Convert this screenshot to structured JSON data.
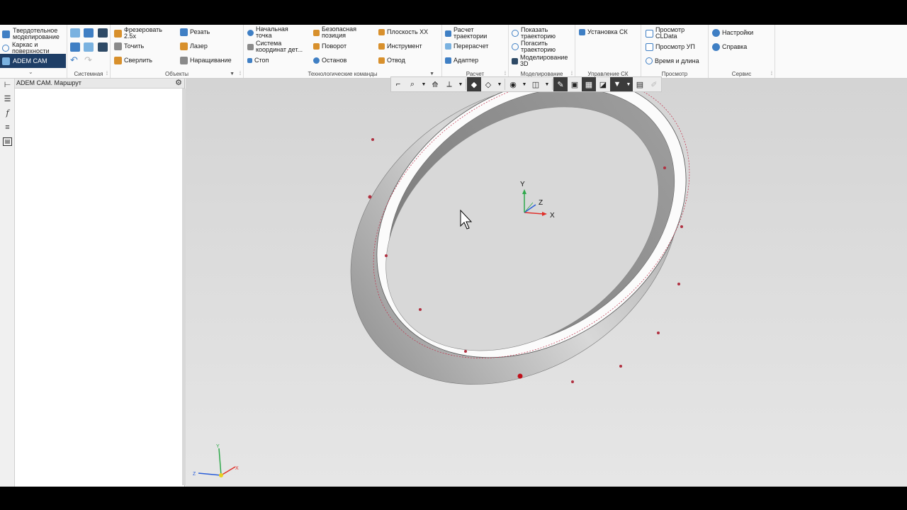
{
  "modes": [
    {
      "label": "Твердотельное\nмоделирование"
    },
    {
      "label": "Каркас и\nповерхности"
    },
    {
      "label": "ADEM CAM"
    }
  ],
  "groups": {
    "system": "Системная",
    "objects": "Объекты",
    "tech": "Технологические команды",
    "calc": "Расчет",
    "modeling": "Моделирование",
    "cs": "Управление СК",
    "view": "Просмотр",
    "service": "Сервис"
  },
  "objects": {
    "mill": "Фрезеровать\n2.5x",
    "turn": "Точить",
    "drill": "Сверлить",
    "cut": "Резать",
    "laser": "Лазер",
    "build": "Наращивание"
  },
  "tech": {
    "start_point": "Начальная\nточка",
    "coord_system": "Система\nкоординат дет...",
    "stop": "Стоп",
    "safe_pos": "Безопасная\nпозиция",
    "rotate": "Поворот",
    "halt": "Останов",
    "plane": "Плоскость XX",
    "tool": "Инструмент",
    "retract": "Отвод"
  },
  "calc": {
    "calc_path": "Расчет\nтраектории",
    "recalc": "Перерасчет",
    "adapter": "Адаптер"
  },
  "modeling": {
    "show_path": "Показать\nтраекторию",
    "hide_path": "Погасить\nтраекторию",
    "model3d": "Моделирование\n3D"
  },
  "cs": {
    "set_cs": "Установка СК"
  },
  "view": {
    "cldata": "Просмотр\nCLData",
    "up": "Просмотр УП",
    "time": "Время и длина"
  },
  "service": {
    "settings": "Настройки",
    "help": "Справка"
  },
  "panel": {
    "title": "ADEM CAM. Маршрут"
  },
  "axes": {
    "x": "X",
    "y": "Y",
    "z": "Z"
  },
  "colors": {
    "mode_active": "#1e3e66",
    "toolpath": "#c0304a",
    "axis_x": "#e0302a",
    "axis_y": "#2ea84a",
    "axis_z": "#2a5ed8"
  }
}
